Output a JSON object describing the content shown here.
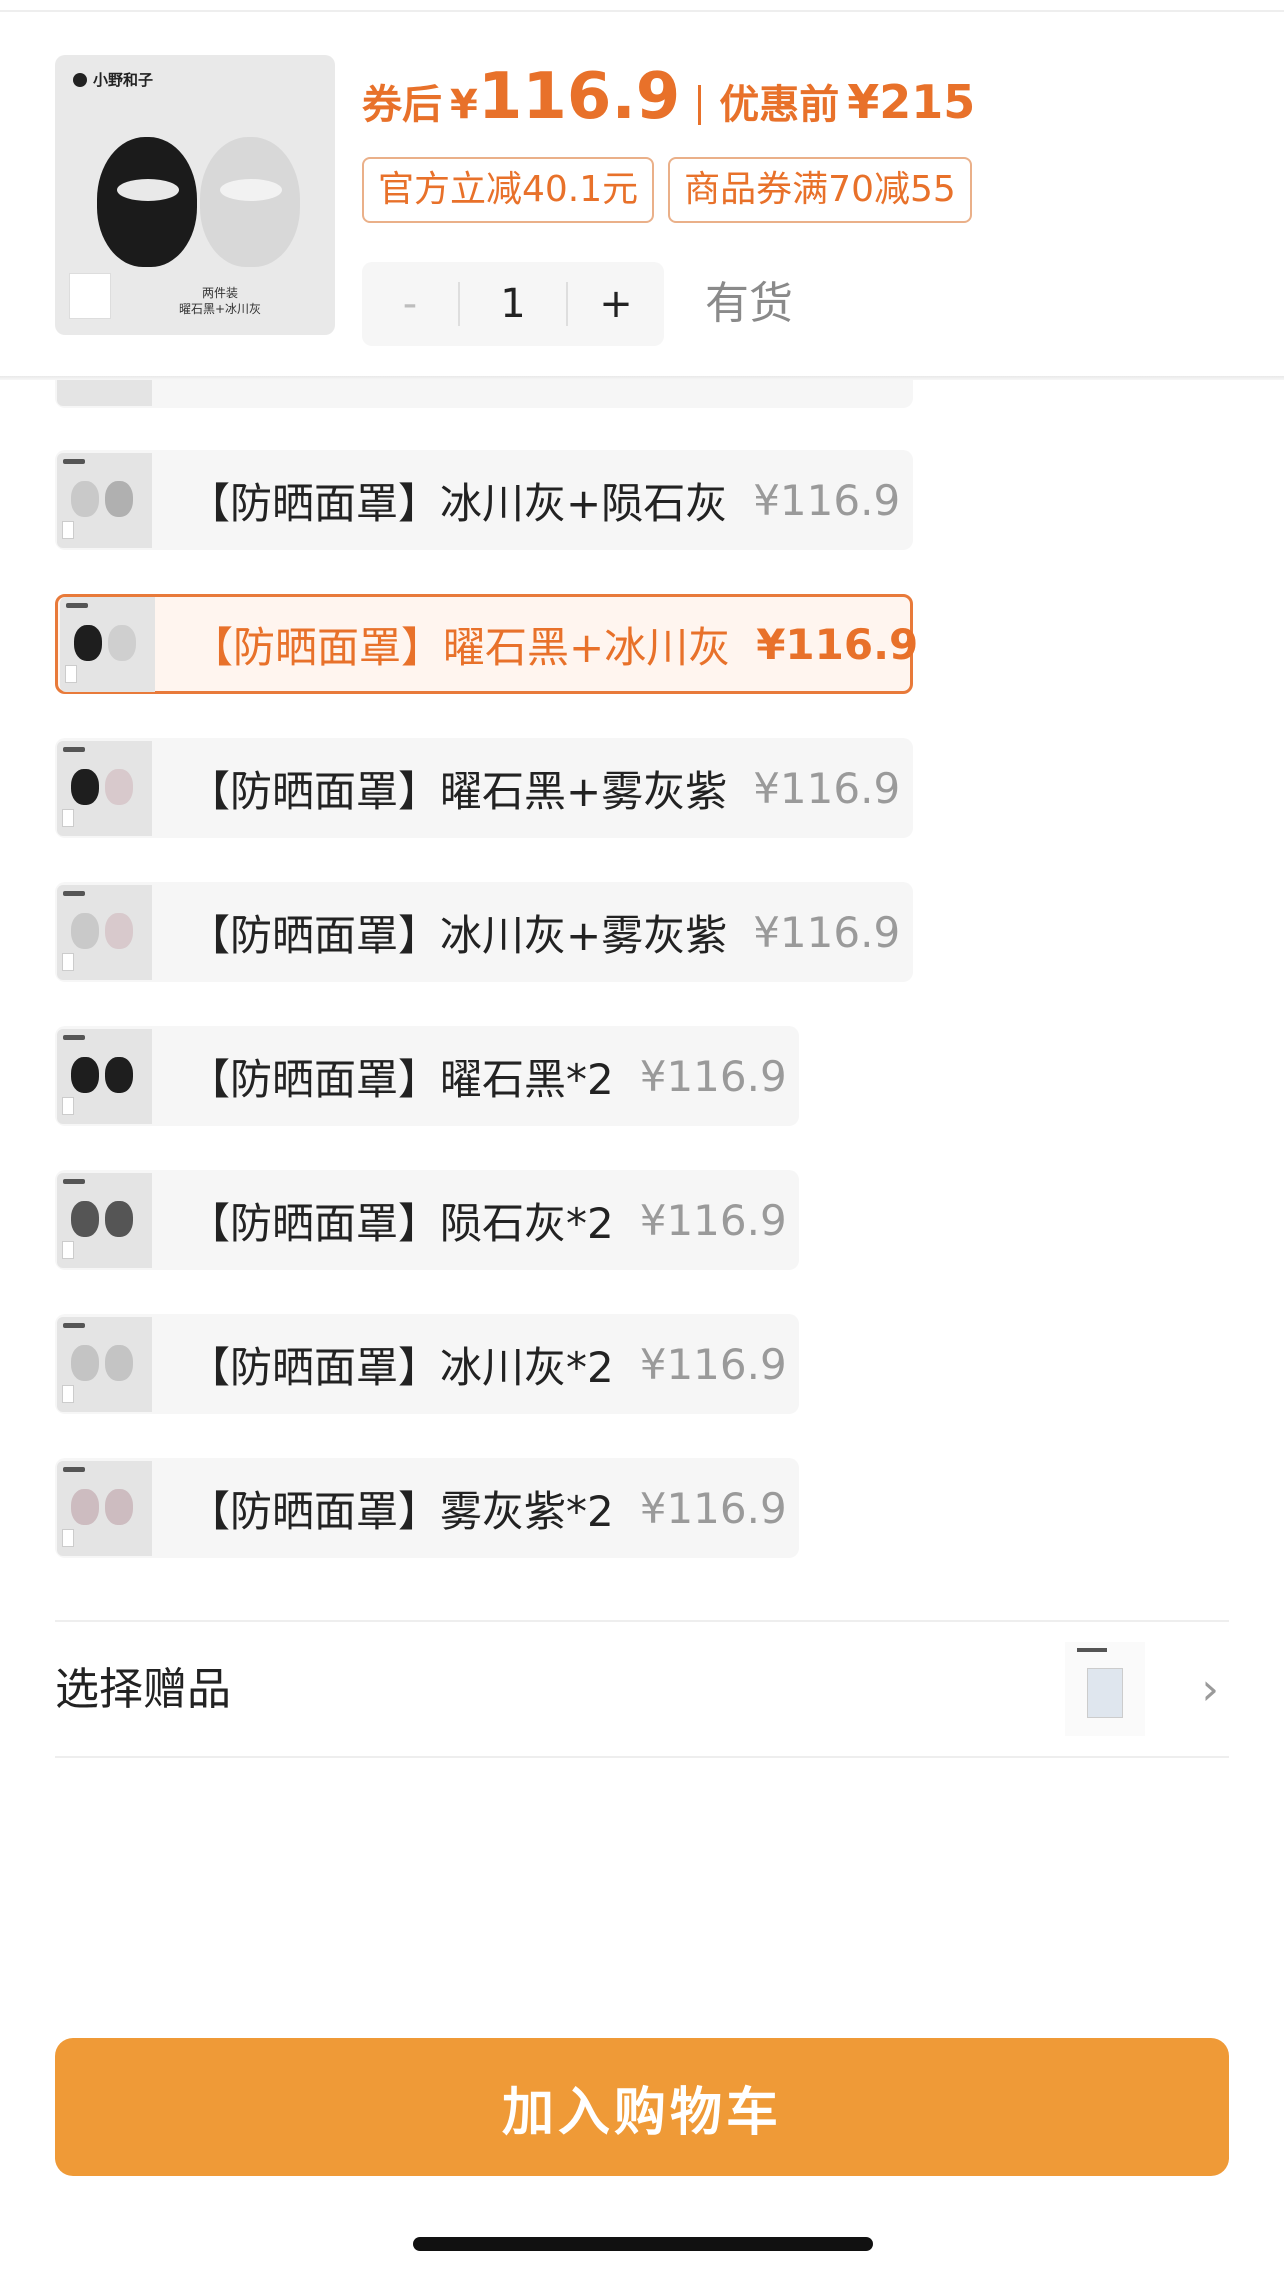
{
  "product": {
    "brand": "小野和子",
    "thumb_caption_line1": "两件装",
    "thumb_caption_line2": "曜石黑+冰川灰",
    "after_coupon_label": "券后",
    "currency": "¥",
    "after_coupon_price": "116.9",
    "before_discount_label": "优惠前",
    "before_discount_price": "¥215",
    "tags": [
      "官方立减40.1元",
      "商品券满70减55"
    ],
    "quantity": "1",
    "minus_label": "-",
    "plus_label": "+",
    "stock_status": "有货"
  },
  "options": [
    {
      "label": "【防晒面罩】冰川灰+陨石灰",
      "price": "¥116.9",
      "colors": [
        "#c9c9c9",
        "#b0b0b0"
      ],
      "selected": false
    },
    {
      "label": "【防晒面罩】曜石黑+冰川灰",
      "price": "¥116.9",
      "colors": [
        "#1e1e1e",
        "#cfcfcf"
      ],
      "selected": true
    },
    {
      "label": "【防晒面罩】曜石黑+雾灰紫",
      "price": "¥116.9",
      "colors": [
        "#1e1e1e",
        "#d8c9cc"
      ],
      "selected": false
    },
    {
      "label": "【防晒面罩】冰川灰+雾灰紫",
      "price": "¥116.9",
      "colors": [
        "#c9c9c9",
        "#d8c9cc"
      ],
      "selected": false
    },
    {
      "label": "【防晒面罩】曜石黑*2",
      "price": "¥116.9",
      "colors": [
        "#1e1e1e",
        "#1e1e1e"
      ],
      "selected": false
    },
    {
      "label": "【防晒面罩】陨石灰*2",
      "price": "¥116.9",
      "colors": [
        "#555555",
        "#555555"
      ],
      "selected": false
    },
    {
      "label": "【防晒面罩】冰川灰*2",
      "price": "¥116.9",
      "colors": [
        "#c4c4c4",
        "#c4c4c4"
      ],
      "selected": false
    },
    {
      "label": "【防晒面罩】雾灰紫*2",
      "price": "¥116.9",
      "colors": [
        "#cdbcc0",
        "#cdbcc0"
      ],
      "selected": false
    }
  ],
  "gift": {
    "label": "选择赠品",
    "chevron_icon": "chevron-right-icon"
  },
  "cart": {
    "button_label": "加入购物车"
  },
  "colors": {
    "accent": "#e8712a",
    "cart_button": "#ef9a37"
  }
}
